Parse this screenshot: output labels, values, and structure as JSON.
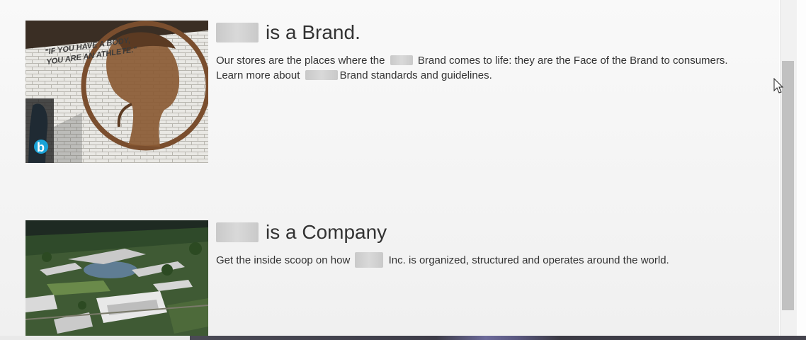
{
  "cards": [
    {
      "title": "is a Brand.",
      "desc_part1": "Our stores are the places where the",
      "desc_part2": "Brand comes to life: they are the Face of the Brand to consumers.",
      "link_prefix": "Learn more about",
      "link_suffix": "Brand standards and guidelines.",
      "image_text_line1": "\"IF YOU HAVE A BODY,",
      "image_text_line2": "YOU ARE AN ATHLETE.\"",
      "image_badge": "b"
    },
    {
      "title": "is a Company",
      "desc_part1": "Get the inside scoop on how",
      "desc_part2": "Inc. is organized, structured and operates around the world."
    }
  ],
  "icons": {
    "cursor": "pointer-cursor-icon"
  }
}
